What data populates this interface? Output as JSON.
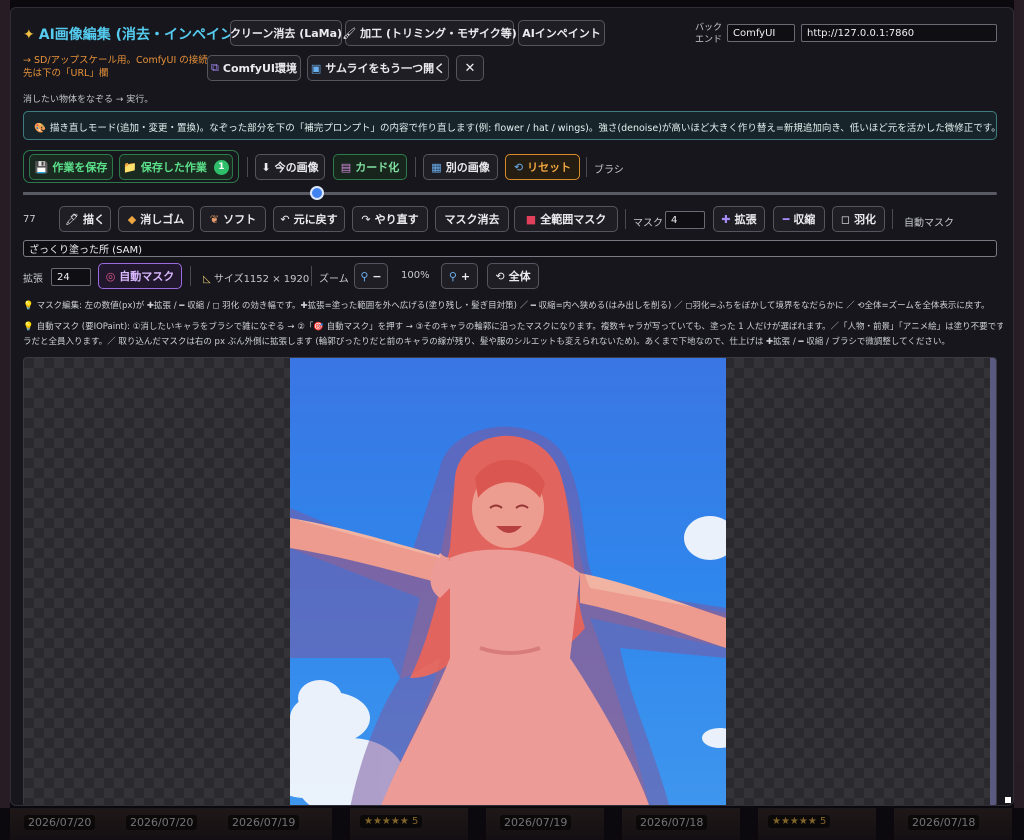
{
  "background": {
    "gallery_tiles": [
      {
        "kind": "date",
        "text": "2026/07/20"
      },
      {
        "kind": "date",
        "text": "2026/07/20"
      },
      {
        "kind": "date",
        "text": "2026/07/19"
      },
      {
        "kind": "stars",
        "text": "★★★★★ 5"
      },
      {
        "kind": "date",
        "text": "2026/07/19"
      },
      {
        "kind": "date",
        "text": "2026/07/18"
      },
      {
        "kind": "stars",
        "text": "★★★★★ 5"
      },
      {
        "kind": "date",
        "text": "2026/07/18"
      }
    ]
  },
  "header": {
    "title": "AI画像編集 (消去・インペイント)",
    "note": "→ SD/アップスケール用。ComfyUI の接続先は下の「URL」欄",
    "instruction": "消したい物体をなぞる → 実行。",
    "tools": {
      "lama": "クリーン消去 (LaMa)",
      "process": "加工 (トリミング・モザイク等)",
      "inpaint": "AIインペイント",
      "comfy_env": "ComfyUI環境",
      "open_another": "サムライをもう一つ開く",
      "close": "✕"
    },
    "backend_label": "バックエンド",
    "backend_value": "ComfyUI",
    "url_value": "http://127.0.0.1:7860"
  },
  "info_banner": "描き直しモード(追加・変更・置換)。なぞった部分を下の「補完プロンプト」の内容で作り直します(例: flower / hat / wings)。強さ(denoise)が高いほど大きく作り替え=新規追加向き、低いほど元を活かした微修正です。",
  "toolbar1": {
    "save_work": "作業を保存",
    "saved_work": "保存した作業",
    "saved_count": "1",
    "current_image": "今の画像",
    "card": "カード化",
    "other_image": "別の画像",
    "reset": "リセット",
    "brush_label": "ブラシ"
  },
  "brush": {
    "size": "77",
    "slider_fraction": 0.302
  },
  "toolbar2": {
    "draw": "描く",
    "eraser": "消しゴム",
    "soft": "ソフト",
    "undo": "元に戻す",
    "redo": "やり直す",
    "mask_erase": "マスク消去",
    "full_mask": "全範囲マスク",
    "mask_label": "マスク",
    "mask_value": "4",
    "expand": "拡張",
    "shrink": "収縮",
    "feather": "羽化",
    "auto_mask_label": "自動マスク"
  },
  "prompt_value": "ざっくり塗った所 (SAM)",
  "toolbar3": {
    "expand_label": "拡張",
    "expand_value": "24",
    "auto_mask": "自動マスク",
    "size": "サイズ1152 × 1920",
    "zoom_label": "ズーム",
    "zoom_out": "−",
    "zoom_value": "100%",
    "zoom_in": "+",
    "fit_all": "全体"
  },
  "hints": {
    "mask_edit": "マスク編集: 左の数値(px)が ✚拡張 / ━ 収縮 / ◻ 羽化 の効き幅です。✚拡張=塗った範囲を外へ広げる(塗り残し・髪ぎ目対策) ／ ━ 収縮=内へ狭める(はみ出しを削る) ／ ◻羽化=ふちをぼかして境界をなだらかに ／ ⟲全体=ズームを全体表示に戻す。",
    "auto_mask_1": "自動マスク (要IOPaint): ①消したいキャラをブラシで雑になぞる → ②「🎯 自動マスク」を押す → ③そのキャラの輪郭に沿ったマスクになります。複数キャラが写っていても、塗った 1 人だけが選ばれます。／「人物・前景」「アニメ絵」は塗り不要ですが前景をまとめて取るので、複数キャ",
    "auto_mask_2": "ラだと全員入ります。／ 取り込んだマスクは右の px ぶん外側に拡張します (輪郭ぴったりだと前のキャラの線が残り、髪や服のシルエットも変えられないため)。あくまで下地なので、仕上げは ✚拡張 / ━ 収縮 / ブラシで微調整してください。"
  }
}
